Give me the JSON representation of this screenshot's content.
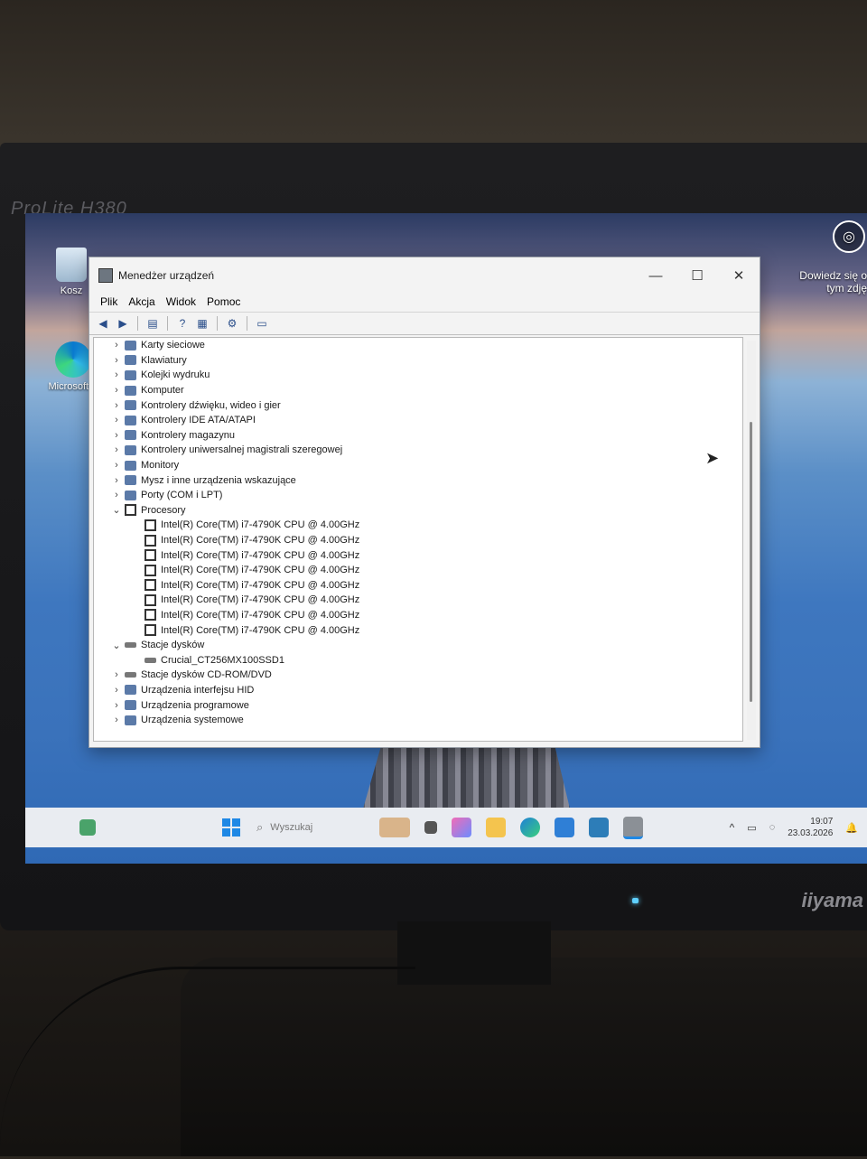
{
  "monitor": {
    "brand_top": "ProLite H380",
    "brand_bottom": "iiyama"
  },
  "desktop": {
    "icons": [
      {
        "label": "Kosz",
        "icon": "recycle-bin-icon"
      },
      {
        "label": "Microsoft E",
        "icon": "edge-icon"
      }
    ],
    "side_panel_text": "Dowiedz się o tym zdję"
  },
  "window": {
    "title": "Menedżer urządzeń",
    "controls": {
      "minimize": "—",
      "maximize": "☐",
      "close": "✕"
    },
    "menu": [
      "Plik",
      "Akcja",
      "Widok",
      "Pomoc"
    ],
    "tree": [
      {
        "chev": "›",
        "label": "Karty sieciowe",
        "icon": "network-adapter-icon",
        "indent": 0
      },
      {
        "chev": "›",
        "label": "Klawiatury",
        "icon": "keyboard-icon",
        "indent": 0
      },
      {
        "chev": "›",
        "label": "Kolejki wydruku",
        "icon": "printer-icon",
        "indent": 0
      },
      {
        "chev": "›",
        "label": "Komputer",
        "icon": "computer-icon",
        "indent": 0
      },
      {
        "chev": "›",
        "label": "Kontrolery dźwięku, wideo i gier",
        "icon": "speaker-icon",
        "indent": 0
      },
      {
        "chev": "›",
        "label": "Kontrolery IDE ATA/ATAPI",
        "icon": "ide-controller-icon",
        "indent": 0
      },
      {
        "chev": "›",
        "label": "Kontrolery magazynu",
        "icon": "storage-controller-icon",
        "indent": 0
      },
      {
        "chev": "›",
        "label": "Kontrolery uniwersalnej magistrali szeregowej",
        "icon": "usb-icon",
        "indent": 0
      },
      {
        "chev": "›",
        "label": "Monitory",
        "icon": "monitor-icon",
        "indent": 0
      },
      {
        "chev": "›",
        "label": "Mysz i inne urządzenia wskazujące",
        "icon": "mouse-icon",
        "indent": 0
      },
      {
        "chev": "›",
        "label": "Porty (COM i LPT)",
        "icon": "port-icon",
        "indent": 0
      },
      {
        "chev": "⌄",
        "label": "Procesory",
        "icon": "cpu-icon",
        "indent": 0
      },
      {
        "chev": "",
        "label": "Intel(R) Core(TM) i7-4790K CPU @ 4.00GHz",
        "icon": "cpu-icon",
        "indent": 1
      },
      {
        "chev": "",
        "label": "Intel(R) Core(TM) i7-4790K CPU @ 4.00GHz",
        "icon": "cpu-icon",
        "indent": 1
      },
      {
        "chev": "",
        "label": "Intel(R) Core(TM) i7-4790K CPU @ 4.00GHz",
        "icon": "cpu-icon",
        "indent": 1
      },
      {
        "chev": "",
        "label": "Intel(R) Core(TM) i7-4790K CPU @ 4.00GHz",
        "icon": "cpu-icon",
        "indent": 1
      },
      {
        "chev": "",
        "label": "Intel(R) Core(TM) i7-4790K CPU @ 4.00GHz",
        "icon": "cpu-icon",
        "indent": 1
      },
      {
        "chev": "",
        "label": "Intel(R) Core(TM) i7-4790K CPU @ 4.00GHz",
        "icon": "cpu-icon",
        "indent": 1
      },
      {
        "chev": "",
        "label": "Intel(R) Core(TM) i7-4790K CPU @ 4.00GHz",
        "icon": "cpu-icon",
        "indent": 1
      },
      {
        "chev": "",
        "label": "Intel(R) Core(TM) i7-4790K CPU @ 4.00GHz",
        "icon": "cpu-icon",
        "indent": 1
      },
      {
        "chev": "⌄",
        "label": "Stacje dysków",
        "icon": "disk-drive-icon",
        "indent": 0
      },
      {
        "chev": "",
        "label": "Crucial_CT256MX100SSD1",
        "icon": "disk-drive-icon",
        "indent": 1
      },
      {
        "chev": "›",
        "label": "Stacje dysków CD-ROM/DVD",
        "icon": "cdrom-icon",
        "indent": 0
      },
      {
        "chev": "›",
        "label": "Urządzenia interfejsu HID",
        "icon": "hid-icon",
        "indent": 0
      },
      {
        "chev": "›",
        "label": "Urządzenia programowe",
        "icon": "software-device-icon",
        "indent": 0
      },
      {
        "chev": "›",
        "label": "Urządzenia systemowe",
        "icon": "system-device-icon",
        "indent": 0
      }
    ]
  },
  "taskbar": {
    "search_placeholder": "Wyszukaj",
    "time": "19:07",
    "date": "23.03.2026"
  }
}
